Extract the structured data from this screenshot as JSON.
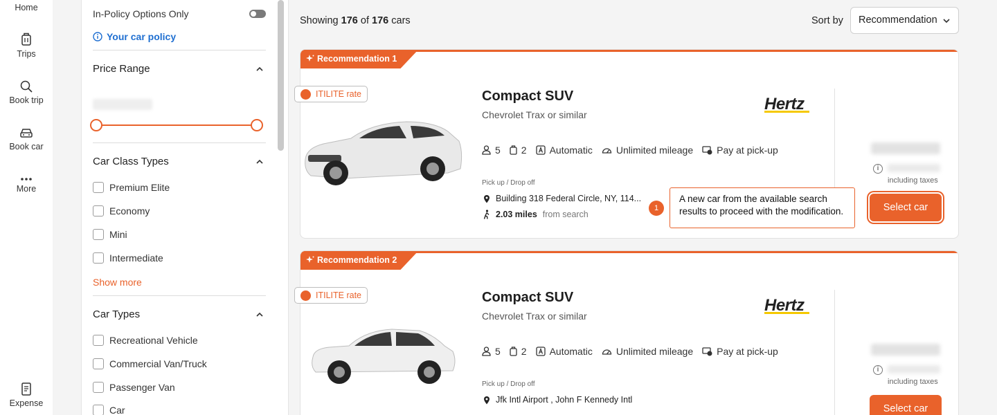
{
  "nav": {
    "home": "Home",
    "trips": "Trips",
    "book_trip": "Book trip",
    "book_car": "Book car",
    "more": "More",
    "expense": "Expense"
  },
  "filters": {
    "in_policy_label": "In-Policy Options Only",
    "policy_link": "Your car policy",
    "price_range_title": "Price Range",
    "car_class_title": "Car Class Types",
    "car_class_options": [
      "Premium Elite",
      "Economy",
      "Mini",
      "Intermediate"
    ],
    "show_more": "Show more",
    "car_types_title": "Car Types",
    "car_type_options": [
      "Recreational Vehicle",
      "Commercial Van/Truck",
      "Passenger Van",
      "Car"
    ]
  },
  "results": {
    "showing_prefix": "Showing",
    "showing_count": "176",
    "showing_of": "of",
    "showing_total": "176",
    "showing_suffix": "cars",
    "sort_label": "Sort by",
    "sort_value": "Recommendation"
  },
  "cards": [
    {
      "tag": "Recommendation 1",
      "rate_badge": "ITILITE rate",
      "title": "Compact SUV",
      "subtitle": "Chevrolet Trax or similar",
      "vendor": "Hertz",
      "seats": "5",
      "bags": "2",
      "transmission": "Automatic",
      "mileage": "Unlimited mileage",
      "payment": "Pay at pick-up",
      "pickup_label": "Pick up / Drop off",
      "location": "Building 318 Federal Circle, NY, 114...",
      "distance": "2.03 miles",
      "distance_suffix": "from search",
      "taxes_note": "including taxes",
      "select_label": "Select car"
    },
    {
      "tag": "Recommendation 2",
      "rate_badge": "ITILITE rate",
      "title": "Compact SUV",
      "subtitle": "Chevrolet Trax or similar",
      "vendor": "Hertz",
      "seats": "5",
      "bags": "2",
      "transmission": "Automatic",
      "mileage": "Unlimited mileage",
      "payment": "Pay at pick-up",
      "pickup_label": "Pick up / Drop off",
      "location": "Jfk Intl Airport , John F Kennedy Intl",
      "taxes_note": "including taxes",
      "select_label": "Select car"
    }
  ],
  "callout": {
    "number": "1",
    "text": "A new car from the available search results to proceed with the modification."
  },
  "colors": {
    "accent": "#e9622b",
    "link": "#1f6fd1"
  }
}
